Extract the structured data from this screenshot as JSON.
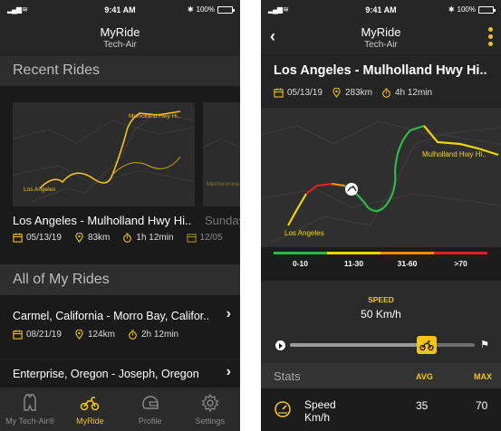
{
  "status_bar": {
    "time": "9:41 AM",
    "battery": "100%"
  },
  "left": {
    "nav": {
      "title": "MyRide",
      "subtitle": "Tech-Air"
    },
    "recent_header": "Recent Rides",
    "card": {
      "title": "Los Angeles - Mulholland Hwy Hi..",
      "date": "05/13/19",
      "distance": "83km",
      "duration": "1h 12min",
      "map_labels": {
        "start": "Los Angeles",
        "end": "Mulholland Hwy Hi.."
      }
    },
    "card_next": {
      "title": "Sunday",
      "date": "12/05",
      "map_label": "Mezzocorona"
    },
    "all_header": "All of My Rides",
    "rides": [
      {
        "title": "Carmel, California - Morro Bay, Califor..",
        "date": "08/21/19",
        "distance": "124km",
        "duration": "2h 12min"
      },
      {
        "title": "Enterprise, Oregon - Joseph, Oregon"
      }
    ],
    "tabs": [
      {
        "label": "My Tech-Air®",
        "icon": "vest-icon"
      },
      {
        "label": "MyRide",
        "icon": "motorbike-icon"
      },
      {
        "label": "Profile",
        "icon": "helmet-icon"
      },
      {
        "label": "Settings",
        "icon": "gear-icon"
      }
    ],
    "active_tab": "MyRide"
  },
  "right": {
    "nav": {
      "title": "MyRide",
      "subtitle": "Tech-Air"
    },
    "route": {
      "title": "Los Angeles - Mulholland Hwy Hi..",
      "date": "05/13/19",
      "distance": "283km",
      "duration": "4h 12min"
    },
    "map_labels": {
      "start": "Los Angeles",
      "end": "Mulholland Hwy Hi.."
    },
    "legend": [
      {
        "label": "0-10",
        "color": "#2fb84a"
      },
      {
        "label": "11-30",
        "color": "#f2d600"
      },
      {
        "label": "31-60",
        "color": "#f08a00"
      },
      {
        "label": ">70",
        "color": "#e02020"
      }
    ],
    "speed": {
      "label": "SPEED",
      "value": "50 Km/h"
    },
    "timeline_progress": 0.74,
    "stats": {
      "title": "Stats",
      "avg_label": "AVG",
      "max_label": "MAX",
      "rows": [
        {
          "name_line1": "Speed",
          "name_line2": "Km/h",
          "avg": "35",
          "max": "70"
        }
      ]
    }
  },
  "colors": {
    "accent": "#f2c318",
    "background": "#1f1f1f"
  }
}
